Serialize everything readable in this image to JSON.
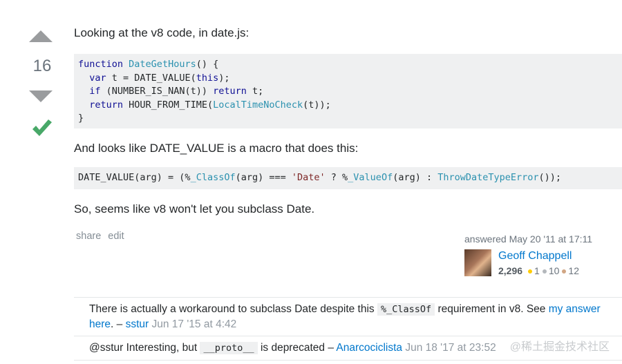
{
  "vote": {
    "count": "16"
  },
  "post": {
    "intro": "Looking at the v8 code, in date.js:",
    "code1": [
      [
        {
          "t": "function",
          "c": "kw"
        },
        {
          "t": " "
        },
        {
          "t": "DateGetHours",
          "c": "fn"
        },
        {
          "t": "() {"
        }
      ],
      [
        {
          "t": "  "
        },
        {
          "t": "var",
          "c": "kw"
        },
        {
          "t": " t = DATE_VALUE("
        },
        {
          "t": "this",
          "c": "kw"
        },
        {
          "t": ");"
        }
      ],
      [
        {
          "t": "  "
        },
        {
          "t": "if",
          "c": "kw"
        },
        {
          "t": " (NUMBER_IS_NAN(t)) "
        },
        {
          "t": "return",
          "c": "kw"
        },
        {
          "t": " t;"
        }
      ],
      [
        {
          "t": "  "
        },
        {
          "t": "return",
          "c": "kw"
        },
        {
          "t": " HOUR_FROM_TIME("
        },
        {
          "t": "LocalTimeNoCheck",
          "c": "fn"
        },
        {
          "t": "(t));"
        }
      ],
      [
        {
          "t": "}"
        }
      ]
    ],
    "para2": "And looks like DATE_VALUE is a macro that does this:",
    "code2": [
      [
        {
          "t": "DATE_VALUE(arg) = (%"
        },
        {
          "t": "_ClassOf",
          "c": "fn"
        },
        {
          "t": "(arg) === "
        },
        {
          "t": "'Date'",
          "c": "str"
        },
        {
          "t": " ? %"
        },
        {
          "t": "_ValueOf",
          "c": "fn"
        },
        {
          "t": "(arg) : "
        },
        {
          "t": "ThrowDateTypeError",
          "c": "fn"
        },
        {
          "t": "());"
        }
      ]
    ],
    "para3": "So, seems like v8 won't let you subclass Date."
  },
  "menu": {
    "share": "share",
    "edit": "edit"
  },
  "signature": {
    "action": "answered May 20 '11 at 17:11",
    "name": "Geoff Chappell",
    "reputation": "2,296",
    "gold": "1",
    "silver": "10",
    "bronze": "12"
  },
  "comments": [
    {
      "before": "There is actually a workaround to subclass Date despite this ",
      "code": "%_ClassOf",
      "after": " requirement in v8. See ",
      "link": "my answer here",
      "dash": ". – ",
      "user": "sstur",
      "date": "Jun 17 '15 at 4:42"
    },
    {
      "before": "@sstur Interesting, but ",
      "code": "__proto__",
      "after": " is deprecated – ",
      "user": "Anarcociclista",
      "date": "Jun 18 '17 at 23:52"
    }
  ],
  "watermark": "@稀土掘金技术社区",
  "colors": {
    "link": "#0077cc",
    "accepted": "#48a868",
    "code_bg": "#eff0f1"
  }
}
